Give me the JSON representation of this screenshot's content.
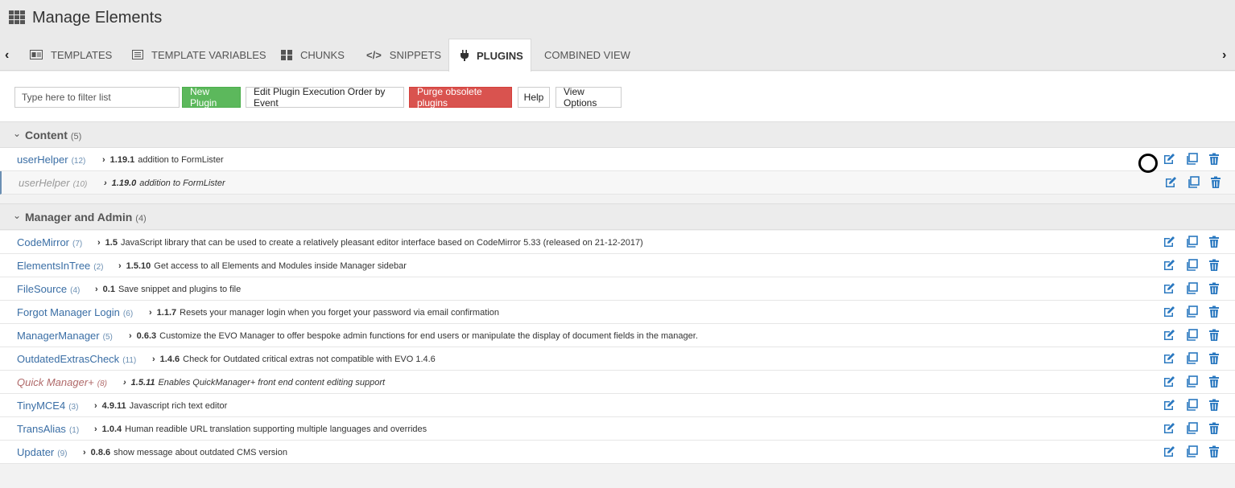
{
  "header": {
    "title": "Manage Elements"
  },
  "tabs": [
    {
      "label": "Templates",
      "icon": "template-icon"
    },
    {
      "label": "Template Variables",
      "icon": "list-icon"
    },
    {
      "label": "Chunks",
      "icon": "grid-icon"
    },
    {
      "label": "Snippets",
      "icon": "code-icon"
    },
    {
      "label": "Plugins",
      "icon": "plug-icon",
      "active": true
    },
    {
      "label": "Combined View",
      "icon": ""
    }
  ],
  "toolbar": {
    "filter_placeholder": "Type here to filter list",
    "new_plugin": "New Plugin",
    "edit_order": "Edit Plugin Execution Order by Event",
    "purge": "Purge obsolete plugins",
    "help": "Help",
    "view_options": "View Options"
  },
  "sections": [
    {
      "title": "Content",
      "count": "(5)",
      "rows": [
        {
          "name": "userHelper",
          "count": "(12)",
          "version": "1.19.1",
          "desc": "addition to FormLister"
        },
        {
          "name": "userHelper",
          "count": "(10)",
          "version": "1.19.0",
          "desc": "addition to FormLister",
          "state": "disabled"
        }
      ]
    },
    {
      "title": "Manager and Admin",
      "count": "(4)",
      "rows": [
        {
          "name": "CodeMirror",
          "count": "(7)",
          "version": "1.5",
          "desc": "JavaScript library that can be used to create a relatively pleasant editor interface based on CodeMirror 5.33 (released on 21-12-2017)"
        },
        {
          "name": "ElementsInTree",
          "count": "(2)",
          "version": "1.5.10",
          "desc": "Get access to all Elements and Modules inside Manager sidebar"
        },
        {
          "name": "FileSource",
          "count": "(4)",
          "version": "0.1",
          "desc": "Save snippet and plugins to file"
        },
        {
          "name": "Forgot Manager Login",
          "count": "(6)",
          "version": "1.1.7",
          "desc": "Resets your manager login when you forget your password via email confirmation"
        },
        {
          "name": "ManagerManager",
          "count": "(5)",
          "version": "0.6.3",
          "desc": "Customize the EVO Manager to offer bespoke admin functions for end users or manipulate the display of document fields in the manager."
        },
        {
          "name": "OutdatedExtrasCheck",
          "count": "(11)",
          "version": "1.4.6",
          "desc": "Check for Outdated critical extras not compatible with EVO 1.4.6"
        },
        {
          "name": "Quick Manager+",
          "count": "(8)",
          "version": "1.5.11",
          "desc": "Enables QuickManager+ front end content editing support",
          "state": "locked"
        },
        {
          "name": "TinyMCE4",
          "count": "(3)",
          "version": "4.9.11",
          "desc": "Javascript rich text editor"
        },
        {
          "name": "TransAlias",
          "count": "(1)",
          "version": "1.0.4",
          "desc": "Human readible URL translation supporting multiple languages and overrides"
        },
        {
          "name": "Updater",
          "count": "(9)",
          "version": "0.8.6",
          "desc": "show message about outdated CMS version"
        }
      ]
    }
  ],
  "colors": {
    "accent": "#3a6ea5",
    "green": "#5cb85c",
    "red": "#d9534f",
    "icon": "#2a78c0"
  }
}
